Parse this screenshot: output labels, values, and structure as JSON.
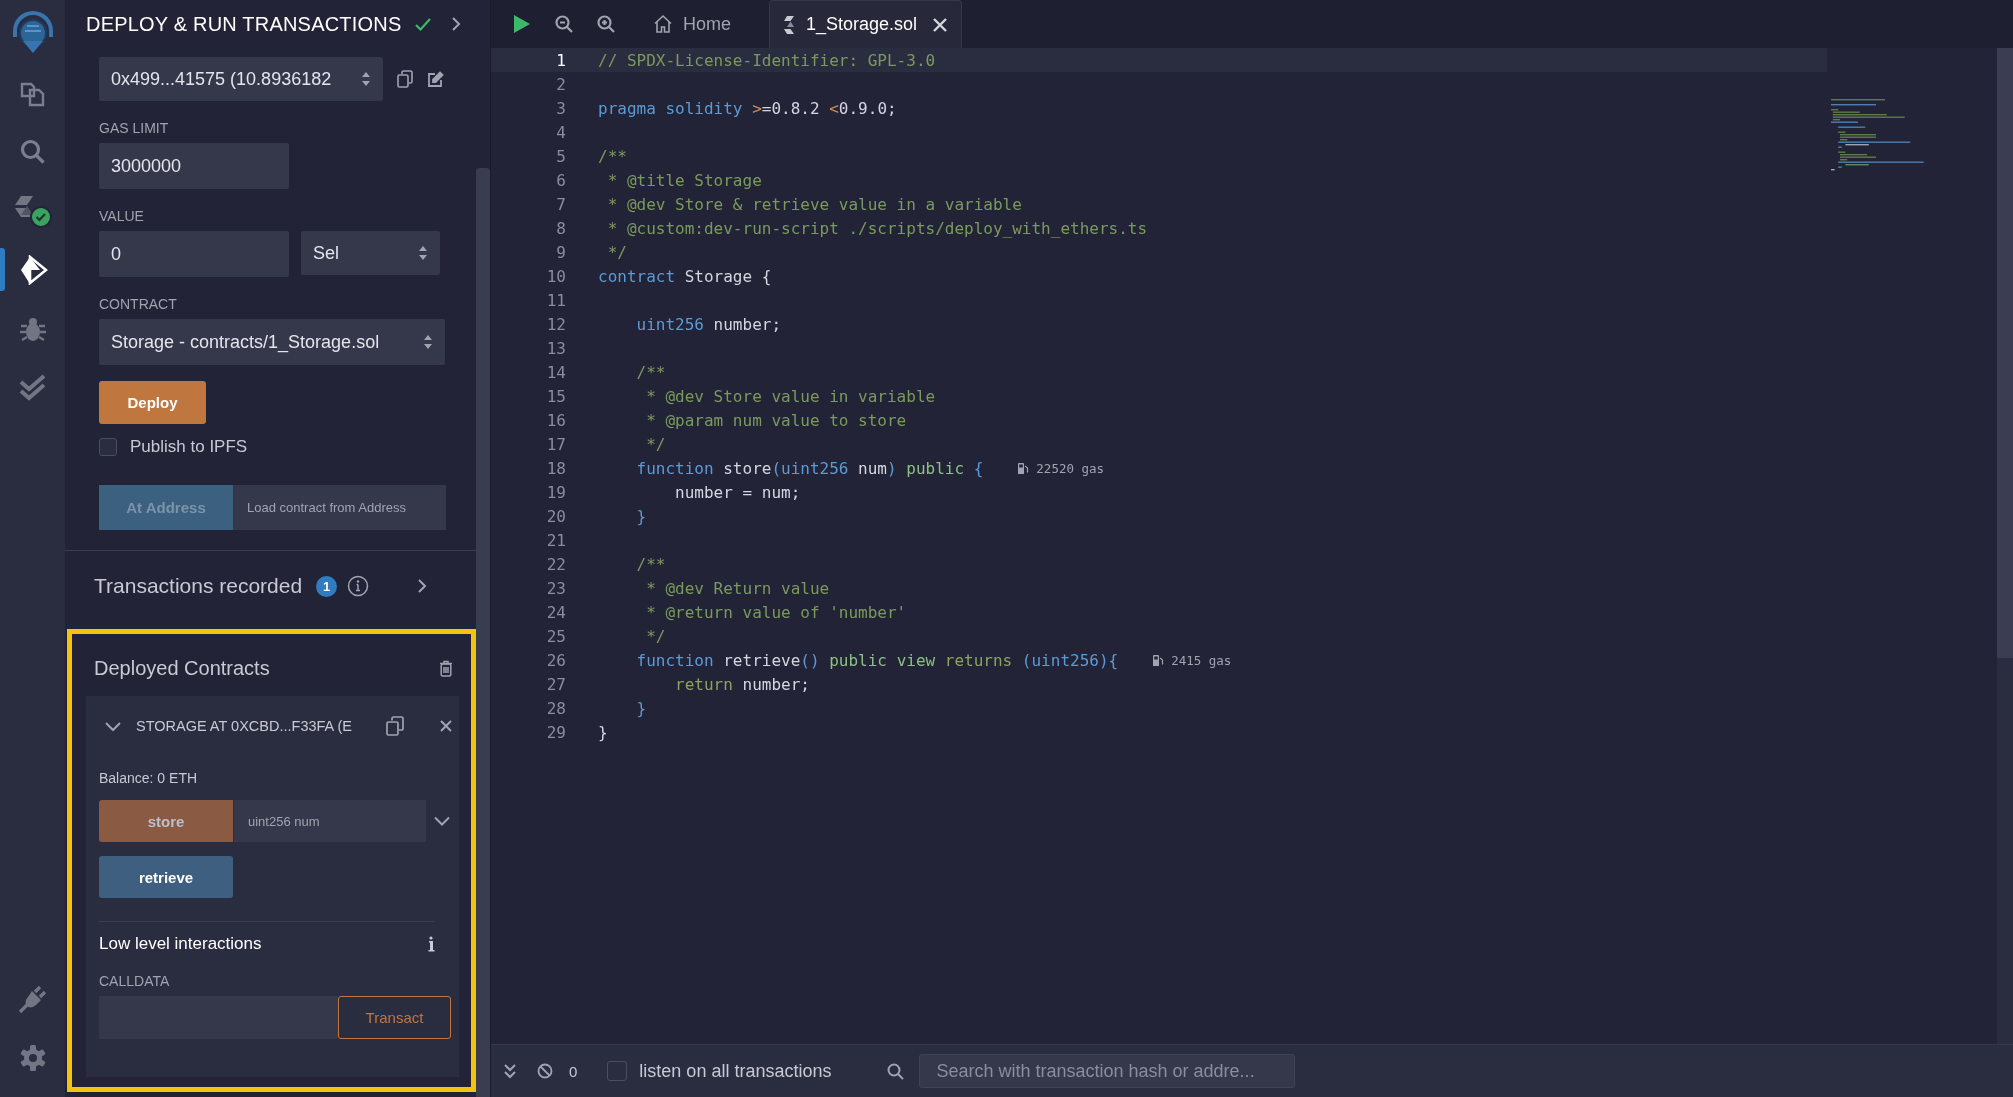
{
  "icon_bar": {
    "top": [
      {
        "kind": "logo"
      },
      {
        "kind": "files",
        "selected": false
      },
      {
        "kind": "search",
        "selected": false
      },
      {
        "kind": "compiler",
        "selected": false
      },
      {
        "kind": "deploy",
        "selected": true
      },
      {
        "kind": "debugger",
        "selected": false
      },
      {
        "kind": "tests",
        "selected": false
      }
    ],
    "bottom": [
      {
        "kind": "plugins"
      },
      {
        "kind": "settings"
      }
    ]
  },
  "panel": {
    "title": "DEPLOY & RUN TRANSACTIONS",
    "account": {
      "value": "0x499...41575 (10.8936182"
    },
    "gas_limit": {
      "label": "GAS LIMIT",
      "value": "3000000"
    },
    "value": {
      "label": "VALUE",
      "value": "0",
      "unit": "Sel"
    },
    "contract": {
      "label": "CONTRACT",
      "value": "Storage - contracts/1_Storage.sol"
    },
    "deploy_button": "Deploy",
    "publish_ipfs": {
      "label": "Publish to IPFS",
      "checked": false
    },
    "at_address": {
      "button": "At Address",
      "disabled": true,
      "placeholder": "Load contract from Address"
    },
    "transactions_recorded": {
      "label": "Transactions recorded",
      "count": "1"
    },
    "deployed_contracts": {
      "title": "Deployed Contracts",
      "instances": [
        {
          "name": "STORAGE AT 0XCBD...F33FA (E",
          "expanded": true,
          "balance": "Balance: 0 ETH",
          "functions": [
            {
              "name": "store",
              "kind": "transact",
              "placeholder": "uint256 num"
            },
            {
              "name": "retrieve",
              "kind": "call"
            }
          ],
          "low_level": {
            "title": "Low level interactions",
            "calldata_label": "CALLDATA",
            "button": "Transact"
          }
        }
      ]
    }
  },
  "editor": {
    "tabs": [
      {
        "label": "Home",
        "kind": "home",
        "selected": false
      },
      {
        "label": "1_Storage.sol",
        "kind": "file",
        "selected": true
      }
    ],
    "lines": [
      {
        "number": "1",
        "active": true,
        "tokens": [
          {
            "kind": "comment",
            "text": "// SPDX-License-Identifier: GPL-3.0"
          }
        ]
      },
      {
        "number": "2",
        "active": false
      },
      {
        "number": "3",
        "active": false,
        "tokens": [
          {
            "kind": "keyword",
            "text": "pragma solidity"
          },
          {
            "kind": "operator",
            "text": " >"
          },
          {
            "kind": "plain",
            "text": "=0.8.2 "
          },
          {
            "kind": "operator",
            "text": "<"
          },
          {
            "kind": "plain",
            "text": "0.9.0;"
          }
        ]
      },
      {
        "number": "4",
        "active": false
      },
      {
        "number": "5",
        "active": false,
        "tokens": [
          {
            "kind": "comment",
            "text": "/**"
          }
        ]
      },
      {
        "number": "6",
        "active": false,
        "tokens": [
          {
            "kind": "comment",
            "text": " * @title Storage"
          }
        ]
      },
      {
        "number": "7",
        "active": false,
        "tokens": [
          {
            "kind": "comment",
            "text": " * @dev Store & retrieve value in a variable"
          }
        ]
      },
      {
        "number": "8",
        "active": false,
        "tokens": [
          {
            "kind": "comment",
            "text": " * @custom:dev-run-script ./scripts/deploy_with_ethers.ts"
          }
        ]
      },
      {
        "number": "9",
        "active": false,
        "tokens": [
          {
            "kind": "comment",
            "text": " */"
          }
        ]
      },
      {
        "number": "10",
        "active": false,
        "tokens": [
          {
            "kind": "keyword",
            "text": "contract"
          },
          {
            "kind": "plain",
            "text": " Storage {"
          }
        ]
      },
      {
        "number": "11",
        "active": false
      },
      {
        "number": "12",
        "active": false,
        "tokens": [
          {
            "kind": "keyword",
            "text": "    uint256"
          },
          {
            "kind": "plain",
            "text": " number;"
          }
        ]
      },
      {
        "number": "13",
        "active": false
      },
      {
        "number": "14",
        "active": false,
        "tokens": [
          {
            "kind": "comment",
            "text": "    /**"
          }
        ]
      },
      {
        "number": "15",
        "active": false,
        "tokens": [
          {
            "kind": "comment",
            "text": "     * @dev Store value in variable"
          }
        ]
      },
      {
        "number": "16",
        "active": false,
        "tokens": [
          {
            "kind": "comment",
            "text": "     * @param num value to store"
          }
        ]
      },
      {
        "number": "17",
        "active": false,
        "tokens": [
          {
            "kind": "comment",
            "text": "     */"
          }
        ]
      },
      {
        "number": "18",
        "active": false,
        "tokens": [
          {
            "kind": "keyword",
            "text": "    function"
          },
          {
            "kind": "plain",
            "text": " store"
          },
          {
            "kind": "keyword",
            "text": "(uint256"
          },
          {
            "kind": "plain",
            "text": " num"
          },
          {
            "kind": "keyword",
            "text": ")"
          },
          {
            "kind": "modifier",
            "text": " public"
          },
          {
            "kind": "keyword",
            "text": " {"
          }
        ],
        "gas": "22520 gas"
      },
      {
        "number": "19",
        "active": false,
        "tokens": [
          {
            "kind": "plain",
            "text": "        number = num;"
          }
        ]
      },
      {
        "number": "20",
        "active": false,
        "tokens": [
          {
            "kind": "keyword",
            "text": "    }"
          }
        ]
      },
      {
        "number": "21",
        "active": false
      },
      {
        "number": "22",
        "active": false,
        "tokens": [
          {
            "kind": "comment",
            "text": "    /**"
          }
        ]
      },
      {
        "number": "23",
        "active": false,
        "tokens": [
          {
            "kind": "comment",
            "text": "     * @dev Return value"
          }
        ]
      },
      {
        "number": "24",
        "active": false,
        "tokens": [
          {
            "kind": "comment",
            "text": "     * @return value of 'number'"
          }
        ]
      },
      {
        "number": "25",
        "active": false,
        "tokens": [
          {
            "kind": "comment",
            "text": "     */"
          }
        ]
      },
      {
        "number": "26",
        "active": false,
        "tokens": [
          {
            "kind": "keyword",
            "text": "    function"
          },
          {
            "kind": "plain",
            "text": " retrieve"
          },
          {
            "kind": "keyword",
            "text": "()"
          },
          {
            "kind": "modifier",
            "text": " public view"
          },
          {
            "kind": "return",
            "text": " returns"
          },
          {
            "kind": "keyword",
            "text": " (uint256){"
          }
        ],
        "gas": "2415 gas"
      },
      {
        "number": "27",
        "active": false,
        "tokens": [
          {
            "kind": "return",
            "text": "        return"
          },
          {
            "kind": "plain",
            "text": " number;"
          }
        ]
      },
      {
        "number": "28",
        "active": false,
        "tokens": [
          {
            "kind": "keyword",
            "text": "    }"
          }
        ]
      },
      {
        "number": "29",
        "active": false,
        "tokens": [
          {
            "kind": "plain",
            "text": "}"
          }
        ]
      }
    ]
  },
  "terminal": {
    "pending_count": "0",
    "listen": {
      "label": "listen on all transactions",
      "checked": false
    },
    "search": {
      "placeholder": "Search with transaction hash or addre..."
    }
  }
}
